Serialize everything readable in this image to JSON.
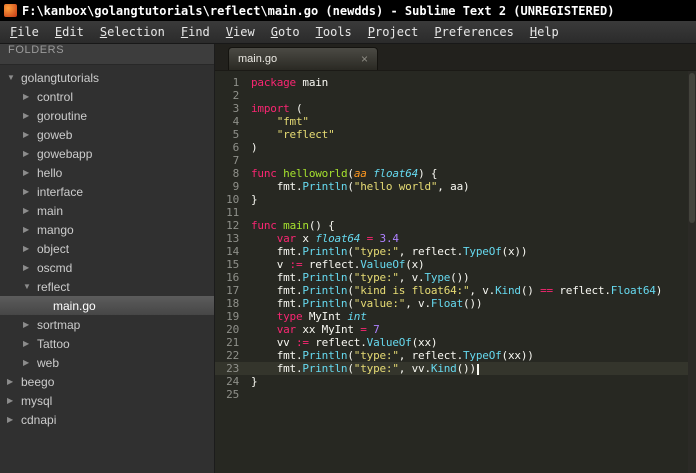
{
  "window": {
    "title": "F:\\kanbox\\golangtutorials\\reflect\\main.go (newdds) - Sublime Text 2 (UNREGISTERED)"
  },
  "menu": {
    "items": [
      "File",
      "Edit",
      "Selection",
      "Find",
      "View",
      "Goto",
      "Tools",
      "Project",
      "Preferences",
      "Help"
    ]
  },
  "sidebar": {
    "header": "FOLDERS",
    "tree": [
      {
        "label": "golangtutorials",
        "level": 0,
        "state": "expanded",
        "type": "folder"
      },
      {
        "label": "control",
        "level": 1,
        "state": "collapsed",
        "type": "folder"
      },
      {
        "label": "goroutine",
        "level": 1,
        "state": "collapsed",
        "type": "folder"
      },
      {
        "label": "goweb",
        "level": 1,
        "state": "collapsed",
        "type": "folder"
      },
      {
        "label": "gowebapp",
        "level": 1,
        "state": "collapsed",
        "type": "folder"
      },
      {
        "label": "hello",
        "level": 1,
        "state": "collapsed",
        "type": "folder"
      },
      {
        "label": "interface",
        "level": 1,
        "state": "collapsed",
        "type": "folder"
      },
      {
        "label": "main",
        "level": 1,
        "state": "collapsed",
        "type": "folder"
      },
      {
        "label": "mango",
        "level": 1,
        "state": "collapsed",
        "type": "folder"
      },
      {
        "label": "object",
        "level": 1,
        "state": "collapsed",
        "type": "folder"
      },
      {
        "label": "oscmd",
        "level": 1,
        "state": "collapsed",
        "type": "folder"
      },
      {
        "label": "reflect",
        "level": 1,
        "state": "expanded",
        "type": "folder"
      },
      {
        "label": "main.go",
        "level": 2,
        "state": "none",
        "type": "file",
        "selected": true
      },
      {
        "label": "sortmap",
        "level": 1,
        "state": "collapsed",
        "type": "folder"
      },
      {
        "label": "Tattoo",
        "level": 1,
        "state": "collapsed",
        "type": "folder"
      },
      {
        "label": "web",
        "level": 1,
        "state": "collapsed",
        "type": "folder"
      },
      {
        "label": "beego",
        "level": 0,
        "state": "collapsed",
        "type": "folder"
      },
      {
        "label": "mysql",
        "level": 0,
        "state": "collapsed",
        "type": "folder"
      },
      {
        "label": "cdnapi",
        "level": 0,
        "state": "collapsed",
        "type": "folder"
      }
    ]
  },
  "tab": {
    "label": "main.go",
    "close": "×"
  },
  "colors": {
    "keyword": "#f92672",
    "string": "#e6db74",
    "number": "#ae81ff",
    "type": "#66d9ef",
    "function": "#a6e22e",
    "editor_bg": "#272822",
    "selection_bg": "#4a4a4a"
  },
  "editor": {
    "cursor_line": 23,
    "lines": [
      {
        "num": 1,
        "tokens": [
          [
            "k",
            "package"
          ],
          [
            "p",
            " main"
          ]
        ]
      },
      {
        "num": 2,
        "tokens": []
      },
      {
        "num": 3,
        "tokens": [
          [
            "k",
            "import"
          ],
          [
            "p",
            " ("
          ]
        ]
      },
      {
        "num": 4,
        "tokens": [
          [
            "p",
            "    "
          ],
          [
            "s",
            "\"fmt\""
          ]
        ]
      },
      {
        "num": 5,
        "tokens": [
          [
            "p",
            "    "
          ],
          [
            "s",
            "\"reflect\""
          ]
        ]
      },
      {
        "num": 6,
        "tokens": [
          [
            "p",
            ")"
          ]
        ]
      },
      {
        "num": 7,
        "tokens": []
      },
      {
        "num": 8,
        "tokens": [
          [
            "k",
            "func"
          ],
          [
            "p",
            " "
          ],
          [
            "f",
            "helloworld"
          ],
          [
            "p",
            "("
          ],
          [
            "a",
            "aa"
          ],
          [
            "p",
            " "
          ],
          [
            "t",
            "float64"
          ],
          [
            "p",
            ") {"
          ]
        ]
      },
      {
        "num": 9,
        "tokens": [
          [
            "p",
            "    fmt."
          ],
          [
            "c",
            "Println"
          ],
          [
            "p",
            "("
          ],
          [
            "s",
            "\"hello world\""
          ],
          [
            "p",
            ", aa)"
          ]
        ]
      },
      {
        "num": 10,
        "tokens": [
          [
            "p",
            "}"
          ]
        ]
      },
      {
        "num": 11,
        "tokens": []
      },
      {
        "num": 12,
        "tokens": [
          [
            "k",
            "func"
          ],
          [
            "p",
            " "
          ],
          [
            "f",
            "main"
          ],
          [
            "p",
            "() {"
          ]
        ]
      },
      {
        "num": 13,
        "tokens": [
          [
            "p",
            "    "
          ],
          [
            "k",
            "var"
          ],
          [
            "p",
            " x "
          ],
          [
            "t",
            "float64"
          ],
          [
            "p",
            " "
          ],
          [
            "o",
            "="
          ],
          [
            "p",
            " "
          ],
          [
            "n",
            "3.4"
          ]
        ]
      },
      {
        "num": 14,
        "tokens": [
          [
            "p",
            "    fmt."
          ],
          [
            "c",
            "Println"
          ],
          [
            "p",
            "("
          ],
          [
            "s",
            "\"type:\""
          ],
          [
            "p",
            ", reflect."
          ],
          [
            "c",
            "TypeOf"
          ],
          [
            "p",
            "(x))"
          ]
        ]
      },
      {
        "num": 15,
        "tokens": [
          [
            "p",
            "    v "
          ],
          [
            "o",
            ":="
          ],
          [
            "p",
            " reflect."
          ],
          [
            "c",
            "ValueOf"
          ],
          [
            "p",
            "(x)"
          ]
        ]
      },
      {
        "num": 16,
        "tokens": [
          [
            "p",
            "    fmt."
          ],
          [
            "c",
            "Println"
          ],
          [
            "p",
            "("
          ],
          [
            "s",
            "\"type:\""
          ],
          [
            "p",
            ", v."
          ],
          [
            "c",
            "Type"
          ],
          [
            "p",
            "())"
          ]
        ]
      },
      {
        "num": 17,
        "tokens": [
          [
            "p",
            "    fmt."
          ],
          [
            "c",
            "Println"
          ],
          [
            "p",
            "("
          ],
          [
            "s",
            "\"kind is float64:\""
          ],
          [
            "p",
            ", v."
          ],
          [
            "c",
            "Kind"
          ],
          [
            "p",
            "() "
          ],
          [
            "o",
            "=="
          ],
          [
            "p",
            " reflect."
          ],
          [
            "c",
            "Float64"
          ],
          [
            "p",
            ")"
          ]
        ]
      },
      {
        "num": 18,
        "tokens": [
          [
            "p",
            "    fmt."
          ],
          [
            "c",
            "Println"
          ],
          [
            "p",
            "("
          ],
          [
            "s",
            "\"value:\""
          ],
          [
            "p",
            ", v."
          ],
          [
            "c",
            "Float"
          ],
          [
            "p",
            "())"
          ]
        ]
      },
      {
        "num": 19,
        "tokens": [
          [
            "p",
            "    "
          ],
          [
            "k",
            "type"
          ],
          [
            "p",
            " MyInt "
          ],
          [
            "t",
            "int"
          ]
        ]
      },
      {
        "num": 20,
        "tokens": [
          [
            "p",
            "    "
          ],
          [
            "k",
            "var"
          ],
          [
            "p",
            " xx MyInt "
          ],
          [
            "o",
            "="
          ],
          [
            "p",
            " "
          ],
          [
            "n",
            "7"
          ]
        ]
      },
      {
        "num": 21,
        "tokens": [
          [
            "p",
            "    vv "
          ],
          [
            "o",
            ":="
          ],
          [
            "p",
            " reflect."
          ],
          [
            "c",
            "ValueOf"
          ],
          [
            "p",
            "(xx)"
          ]
        ]
      },
      {
        "num": 22,
        "tokens": [
          [
            "p",
            "    fmt."
          ],
          [
            "c",
            "Println"
          ],
          [
            "p",
            "("
          ],
          [
            "s",
            "\"type:\""
          ],
          [
            "p",
            ", reflect."
          ],
          [
            "c",
            "TypeOf"
          ],
          [
            "p",
            "(xx))"
          ]
        ]
      },
      {
        "num": 23,
        "tokens": [
          [
            "p",
            "    fmt."
          ],
          [
            "c",
            "Println"
          ],
          [
            "p",
            "("
          ],
          [
            "s",
            "\"type:\""
          ],
          [
            "p",
            ", vv."
          ],
          [
            "c",
            "Kind"
          ],
          [
            "p",
            "())"
          ]
        ]
      },
      {
        "num": 24,
        "tokens": [
          [
            "p",
            "}"
          ]
        ]
      },
      {
        "num": 25,
        "tokens": []
      }
    ]
  }
}
